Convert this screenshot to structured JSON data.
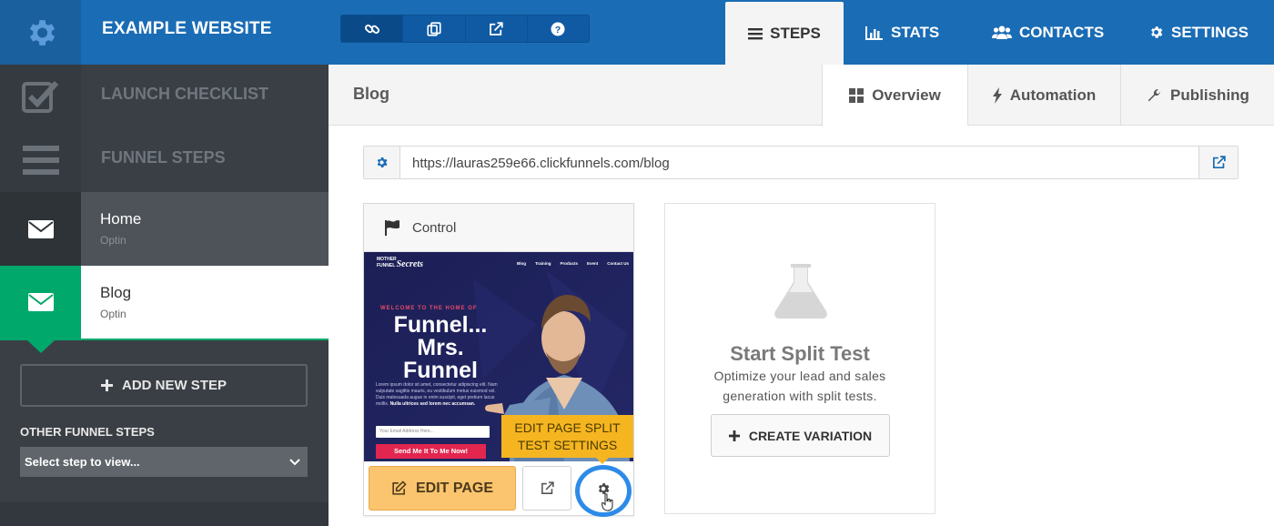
{
  "header": {
    "site_title": "EXAMPLE WEBSITE",
    "tool_icons": [
      "link-icon",
      "copy-icon",
      "external-link-icon",
      "help-icon"
    ],
    "nav": [
      {
        "label": "STEPS",
        "icon": "list-icon",
        "active": true
      },
      {
        "label": "STATS",
        "icon": "bar-chart-icon",
        "active": false
      },
      {
        "label": "CONTACTS",
        "icon": "users-icon",
        "active": false
      },
      {
        "label": "SETTINGS",
        "icon": "gear-icon",
        "active": false
      }
    ]
  },
  "sidebar": {
    "launch_checklist": "LAUNCH CHECKLIST",
    "funnel_steps": "FUNNEL STEPS",
    "steps": [
      {
        "title": "Home",
        "subtitle": "Optin",
        "active": false
      },
      {
        "title": "Blog",
        "subtitle": "Optin",
        "active": true
      }
    ],
    "add_new_step": "ADD NEW STEP",
    "other_funnel_steps": "OTHER FUNNEL STEPS",
    "select_placeholder": "Select step to view..."
  },
  "main": {
    "page_name": "Blog",
    "tabs": [
      {
        "label": "Overview",
        "icon": "grid-icon",
        "active": true
      },
      {
        "label": "Automation",
        "icon": "bolt-icon",
        "active": false
      },
      {
        "label": "Publishing",
        "icon": "wrench-icon",
        "active": false
      }
    ],
    "url": "https://lauras259e66.clickfunnels.com/blog",
    "control": {
      "title": "Control",
      "split_tooltip_line1": "EDIT PAGE SPLIT",
      "split_tooltip_line2": "TEST SETTINGS",
      "edit_page": "EDIT PAGE"
    },
    "preview": {
      "logo_top": "MOTHER",
      "logo_mid": "FUNNEL",
      "logo_script": "Secrets",
      "nav": [
        "Blog",
        "Training",
        "Products",
        "Event",
        "Contact Us"
      ],
      "welcome": "WELCOME TO THE HOME OF",
      "headline1": "Funnel...",
      "headline2": "Mrs.",
      "headline3": "Funnel",
      "body": "Lorem ipsum dolor sit amet, consectetur adipiscing elit. Nam vulputate sagittis mauris, eu vestibulum metus euismod vel. Duis malesuada augue in enim suscipit, eget pretium lacus mollis.",
      "body_bold": "Nulla ultrices sed lorem nec accumsan.",
      "email_placeholder": "Your Email Address Here...",
      "cta": "Send Me It To Me Now!"
    },
    "split": {
      "title": "Start Split Test",
      "description": "Optimize your lead and sales generation with split tests.",
      "create_variation": "CREATE VARIATION"
    }
  },
  "colors": {
    "topbar": "#1a6cb5",
    "sidebar": "#3a3f45",
    "active_step": "#00a86b",
    "edit_button": "#fbc46e",
    "tooltip": "#f5b521",
    "highlight_ring": "#2d8be8"
  }
}
